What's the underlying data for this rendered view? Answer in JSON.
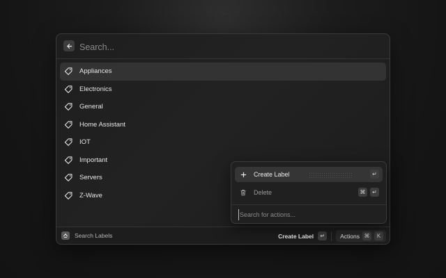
{
  "search": {
    "placeholder": "Search..."
  },
  "labels": [
    {
      "name": "Appliances",
      "selected": true
    },
    {
      "name": "Electronics"
    },
    {
      "name": "General"
    },
    {
      "name": "Home Assistant"
    },
    {
      "name": "IOT"
    },
    {
      "name": "Important"
    },
    {
      "name": "Servers"
    },
    {
      "name": "Z-Wave"
    }
  ],
  "actions_panel": {
    "items": [
      {
        "label": "Create Label",
        "icon": "plus-icon",
        "shortcut": [
          "↵"
        ]
      },
      {
        "label": "Delete",
        "icon": "trash-icon",
        "shortcut": [
          "⌘",
          "↵"
        ]
      }
    ],
    "search_placeholder": "Search for actions..."
  },
  "footer": {
    "title": "Search Labels",
    "primary_action": "Create Label",
    "primary_shortcut": "↵",
    "actions_label": "Actions",
    "actions_shortcut": [
      "⌘",
      "K"
    ]
  }
}
